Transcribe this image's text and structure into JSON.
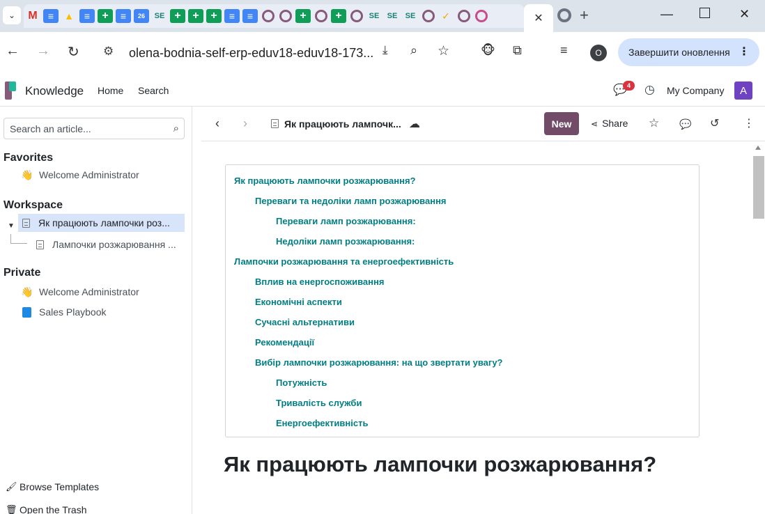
{
  "browser": {
    "tabs_collapsed_icons": [
      "gmail",
      "docs",
      "drive",
      "docs",
      "sheets",
      "docs",
      "calendar",
      "se",
      "sheets",
      "sheets",
      "sheets",
      "docs",
      "docs",
      "odoo",
      "odoo",
      "sheets",
      "odoo",
      "sheets",
      "odoo",
      "se",
      "se",
      "se",
      "odoo",
      "check",
      "odoo",
      "odoo-pink"
    ],
    "calendar_label": "26",
    "se_label": "SE",
    "active_tab_close": "✕",
    "new_tab": "+",
    "url": "olena-bodnia-self-erp-eduv18-eduv18-173...",
    "profile_initial": "O",
    "update_button": "Завершити оновлення"
  },
  "app": {
    "name": "Knowledge",
    "menu": [
      "Home",
      "Search"
    ],
    "chat_badge": "4",
    "company": "My Company",
    "user_initial": "A"
  },
  "sidebar": {
    "search_placeholder": "Search an article...",
    "favorites_title": "Favorites",
    "favorites": [
      {
        "emoji": "👋",
        "label": "Welcome Administrator"
      }
    ],
    "workspace_title": "Workspace",
    "workspace": [
      {
        "label": "Як працюють лампочки роз..."
      },
      {
        "label": "Лампочки розжарювання ..."
      }
    ],
    "private_title": "Private",
    "private": [
      {
        "emoji": "👋",
        "label": "Welcome Administrator"
      },
      {
        "label": "Sales Playbook"
      }
    ],
    "browse_templates": "Browse Templates",
    "open_trash": "Open the Trash"
  },
  "article": {
    "breadcrumb_title": "Як працюють лампочк...",
    "new_label": "New",
    "share_label": "Share",
    "toc": [
      {
        "level": 1,
        "text": "Як працюють лампочки розжарювання?"
      },
      {
        "level": 2,
        "text": "Переваги та недоліки ламп розжарювання"
      },
      {
        "level": 3,
        "text": "Переваги ламп розжарювання:"
      },
      {
        "level": 3,
        "text": "Недоліки ламп розжарювання:"
      },
      {
        "level": 1,
        "text": "Лампочки розжарювання та енергоефективність"
      },
      {
        "level": 2,
        "text": "Вплив на енергоспоживання"
      },
      {
        "level": 2,
        "text": "Економічні аспекти"
      },
      {
        "level": 2,
        "text": "Сучасні альтернативи"
      },
      {
        "level": 2,
        "text": "Рекомендації"
      },
      {
        "level": 2,
        "text": "Вибір лампочки розжарювання: на що звертати увагу?"
      },
      {
        "level": 3,
        "text": "Потужність"
      },
      {
        "level": 3,
        "text": "Тривалість служби"
      },
      {
        "level": 3,
        "text": "Енергоефективність"
      }
    ],
    "heading": "Як працюють лампочки розжарювання?"
  }
}
